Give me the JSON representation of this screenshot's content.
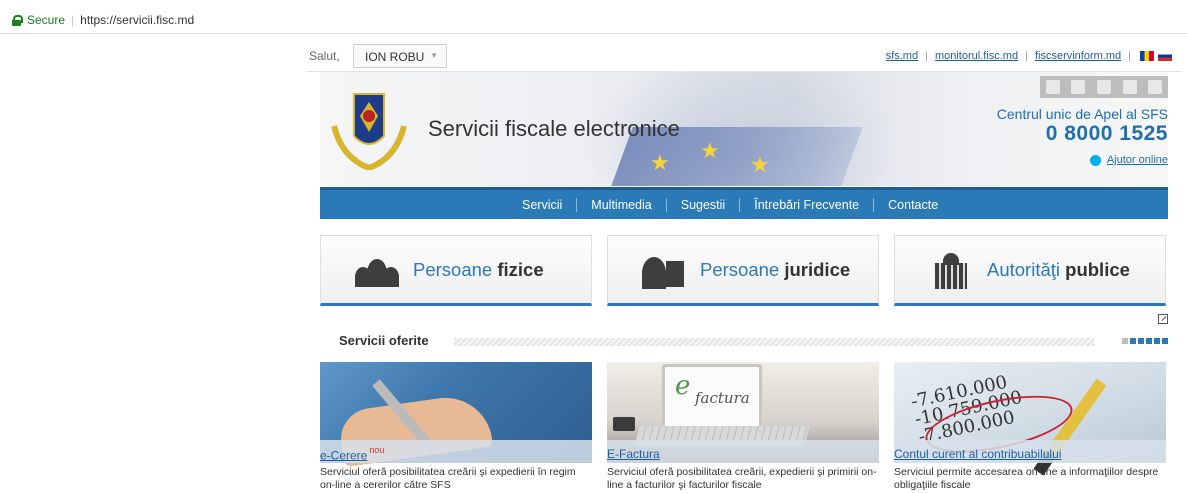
{
  "browser": {
    "secure_label": "Secure",
    "url": "https://servicii.fisc.md"
  },
  "topbar": {
    "greeting": "Salut,",
    "user": "ION ROBU",
    "links": [
      "sfs.md",
      "monitorul.fisc.md",
      "fiscservinform.md"
    ]
  },
  "banner": {
    "title": "Servicii fiscale electronice",
    "call_label": "Centrul unic de Apel al SFS",
    "phone": "0 8000 1525",
    "help_link": "Ajutor online"
  },
  "nav": {
    "items": [
      "Servicii",
      "Multimedia",
      "Sugestii",
      "Întrebări Frecvente",
      "Contacte"
    ]
  },
  "categories": [
    {
      "prefix": "Persoane",
      "bold": "fizice"
    },
    {
      "prefix": "Persoane",
      "bold": "juridice"
    },
    {
      "prefix": "Autorităţi",
      "bold": "publice"
    }
  ],
  "services": {
    "title": "Servicii oferite",
    "cards": [
      {
        "title": "e-Cerere",
        "badge": "nou",
        "desc": "Serviciul oferă posibilitatea creării şi expedierii în regim on-line a cererilor către SFS"
      },
      {
        "title": "E-Factura",
        "badge": "",
        "desc": "Serviciul oferă posibilitatea creării, expedierii şi primirii on-line a facturilor şi facturilor fiscale"
      },
      {
        "title": "Contul curent al contribuabilului",
        "badge": "",
        "desc": "Serviciul permite accesarea on-line a informaţiilor despre obligaţiile fiscale"
      }
    ],
    "efactura_logo_e": "e",
    "efactura_logo_rest": "factura",
    "ledger_numbers": [
      "-7.610.000",
      "-10.759.000",
      "-7.800.000"
    ]
  },
  "colors": {
    "accent": "#2a7ab8",
    "link": "#1f5f9f",
    "secure": "#1b7f1b"
  }
}
